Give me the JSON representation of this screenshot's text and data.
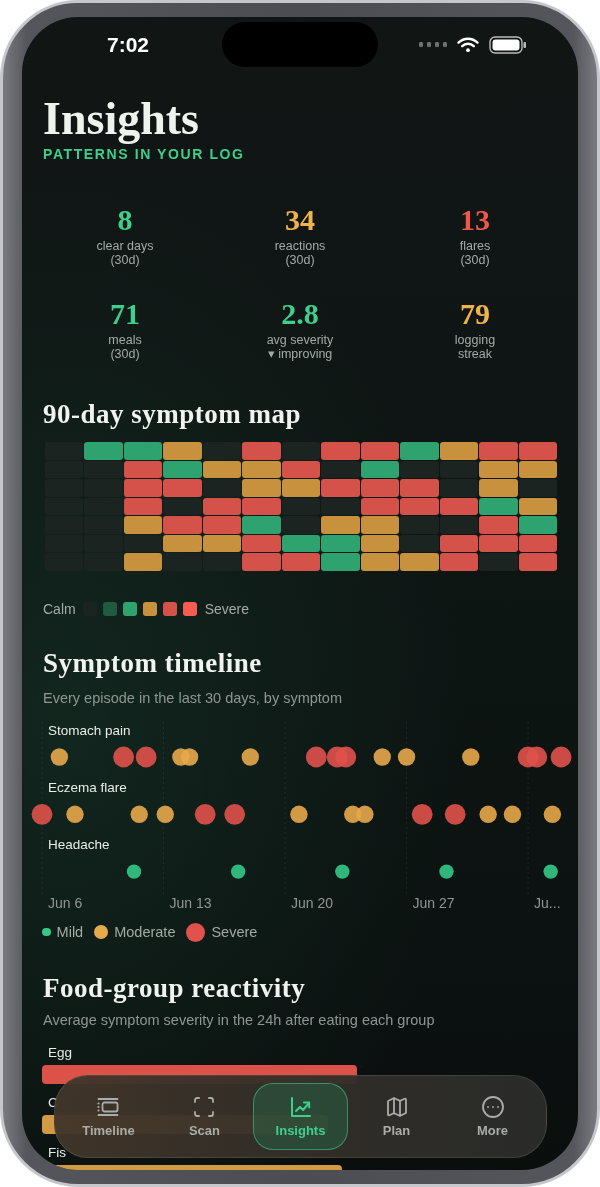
{
  "status_bar": {
    "time": "7:02"
  },
  "header": {
    "title": "Insights",
    "subtitle": "PATTERNS IN YOUR LOG"
  },
  "stats": [
    {
      "value": "8",
      "label": "clear days",
      "note": "(30d)",
      "color": "#3ecf8e"
    },
    {
      "value": "34",
      "label": "reactions",
      "note": "(30d)",
      "color": "#f0b24b"
    },
    {
      "value": "13",
      "label": "flares",
      "note": "(30d)",
      "color": "#ef574d"
    },
    {
      "value": "71",
      "label": "meals",
      "note": "(30d)",
      "color": "#3ecf8e"
    },
    {
      "value": "2.8",
      "label": "avg severity",
      "note": "▾ improving",
      "color": "#3ecf8e"
    },
    {
      "value": "79",
      "label": "logging",
      "note": "streak",
      "color": "#f0b24b"
    }
  ],
  "symptom_map": {
    "title": "90-day symptom map",
    "weeks": [
      {
        "days": [
          {
            "color": "#1c2422"
          },
          {
            "color": "#1c2422"
          },
          {
            "color": "#1c2422"
          },
          {
            "color": "#1c2422"
          },
          {
            "color": "#1c2422"
          },
          {
            "color": "#1c2422"
          },
          {
            "color": "#1c2422"
          }
        ]
      },
      {
        "days": [
          {
            "color": "#2ea36f"
          },
          {
            "color": "#1c2422"
          },
          {
            "color": "#1c2422"
          },
          {
            "color": "#1c2422"
          },
          {
            "color": "#1c2422"
          },
          {
            "color": "#1c2422"
          },
          {
            "color": "#1c2422"
          }
        ]
      },
      {
        "days": [
          {
            "color": "#2ea36f"
          },
          {
            "color": "#d4524a"
          },
          {
            "color": "#d4524a"
          },
          {
            "color": "#d4524a"
          },
          {
            "color": "#c8913e"
          },
          {
            "color": "#1c2422"
          },
          {
            "color": "#c8913e"
          }
        ]
      },
      {
        "days": [
          {
            "color": "#c8913e"
          },
          {
            "color": "#2ea36f"
          },
          {
            "color": "#d4524a"
          },
          {
            "color": "#1c2422"
          },
          {
            "color": "#d4524a"
          },
          {
            "color": "#c8913e"
          },
          {
            "color": "#1c2422"
          }
        ]
      },
      {
        "days": [
          {
            "color": "#1c2422"
          },
          {
            "color": "#c8913e"
          },
          {
            "color": "#1c2422"
          },
          {
            "color": "#d4524a"
          },
          {
            "color": "#d4524a"
          },
          {
            "color": "#c8913e"
          },
          {
            "color": "#1c2422"
          }
        ]
      },
      {
        "days": [
          {
            "color": "#d4524a"
          },
          {
            "color": "#c8913e"
          },
          {
            "color": "#c8913e"
          },
          {
            "color": "#d4524a"
          },
          {
            "color": "#2ea36f"
          },
          {
            "color": "#d4524a"
          },
          {
            "color": "#d4524a"
          }
        ]
      },
      {
        "days": [
          {
            "color": "#1c2422"
          },
          {
            "color": "#d4524a"
          },
          {
            "color": "#c8913e"
          },
          {
            "color": "#1c2422"
          },
          {
            "color": "#1c2422"
          },
          {
            "color": "#2ea36f"
          },
          {
            "color": "#d4524a"
          }
        ]
      },
      {
        "days": [
          {
            "color": "#d4524a"
          },
          {
            "color": "#1c2422"
          },
          {
            "color": "#d4524a"
          },
          {
            "color": "#1c2422"
          },
          {
            "color": "#c8913e"
          },
          {
            "color": "#2ea36f"
          },
          {
            "color": "#2ea36f"
          }
        ]
      },
      {
        "days": [
          {
            "color": "#d4524a"
          },
          {
            "color": "#2ea36f"
          },
          {
            "color": "#d4524a"
          },
          {
            "color": "#d4524a"
          },
          {
            "color": "#c8913e"
          },
          {
            "color": "#c8913e"
          },
          {
            "color": "#c8913e"
          }
        ]
      },
      {
        "days": [
          {
            "color": "#2ea36f"
          },
          {
            "color": "#1c2422"
          },
          {
            "color": "#d4524a"
          },
          {
            "color": "#d4524a"
          },
          {
            "color": "#1c2422"
          },
          {
            "color": "#1c2422"
          },
          {
            "color": "#c8913e"
          }
        ]
      },
      {
        "days": [
          {
            "color": "#c8913e"
          },
          {
            "color": "#1c2422"
          },
          {
            "color": "#1c2422"
          },
          {
            "color": "#d4524a"
          },
          {
            "color": "#1c2422"
          },
          {
            "color": "#d4524a"
          },
          {
            "color": "#d4524a"
          }
        ]
      },
      {
        "days": [
          {
            "color": "#d4524a"
          },
          {
            "color": "#c8913e"
          },
          {
            "color": "#c8913e"
          },
          {
            "color": "#2ea36f"
          },
          {
            "color": "#d4524a"
          },
          {
            "color": "#d4524a"
          },
          {
            "color": "#1c2422"
          }
        ]
      },
      {
        "days": [
          {
            "color": "#d4524a"
          },
          {
            "color": "#c8913e"
          },
          {
            "color": "#1c2422"
          },
          {
            "color": "#c8913e"
          },
          {
            "color": "#2ea36f"
          },
          {
            "color": "#d4524a"
          },
          {
            "color": "#d4524a"
          }
        ]
      }
    ],
    "legend": {
      "low_label": "Calm",
      "high_label": "Severe",
      "swatches": [
        {
          "color": "#1c2422"
        },
        {
          "color": "#1f5b41"
        },
        {
          "color": "#2ea36f"
        },
        {
          "color": "#c8913e"
        },
        {
          "color": "#d4524a"
        },
        {
          "color": "#f65c4f"
        }
      ]
    }
  },
  "symptom_timeline": {
    "title": "Symptom timeline",
    "subtitle": "Every episode in the last 30 days, by symptom",
    "rows": [
      {
        "label": "Stomach pain"
      },
      {
        "label": "Eczema flare"
      },
      {
        "label": "Headache"
      }
    ],
    "date_labels": [
      "Jun 6",
      "Jun 13",
      "Jun 20",
      "Jun 27",
      "Ju..."
    ],
    "legend": [
      {
        "label": "Mild",
        "color": "#34c987"
      },
      {
        "label": "Moderate",
        "color": "#e8a94b"
      },
      {
        "label": "Severe",
        "color": "#e0524b"
      }
    ]
  },
  "food_reactivity": {
    "title": "Food-group reactivity",
    "subtitle": "Average symptom severity in the 24h after eating each group",
    "groups": [
      {
        "name": "Egg",
        "color": "#dc5249"
      },
      {
        "name": "C",
        "color": "#d39a44"
      },
      {
        "name": "Fis",
        "color": "#d39a44"
      }
    ]
  },
  "tab_bar": {
    "tabs": [
      {
        "label": "Timeline",
        "kind": "timeline",
        "selected": false
      },
      {
        "label": "Scan",
        "kind": "scan",
        "selected": false
      },
      {
        "label": "Insights",
        "kind": "insights",
        "selected": true
      },
      {
        "label": "Plan",
        "kind": "plan",
        "selected": false
      },
      {
        "label": "More",
        "kind": "more",
        "selected": false
      }
    ]
  }
}
